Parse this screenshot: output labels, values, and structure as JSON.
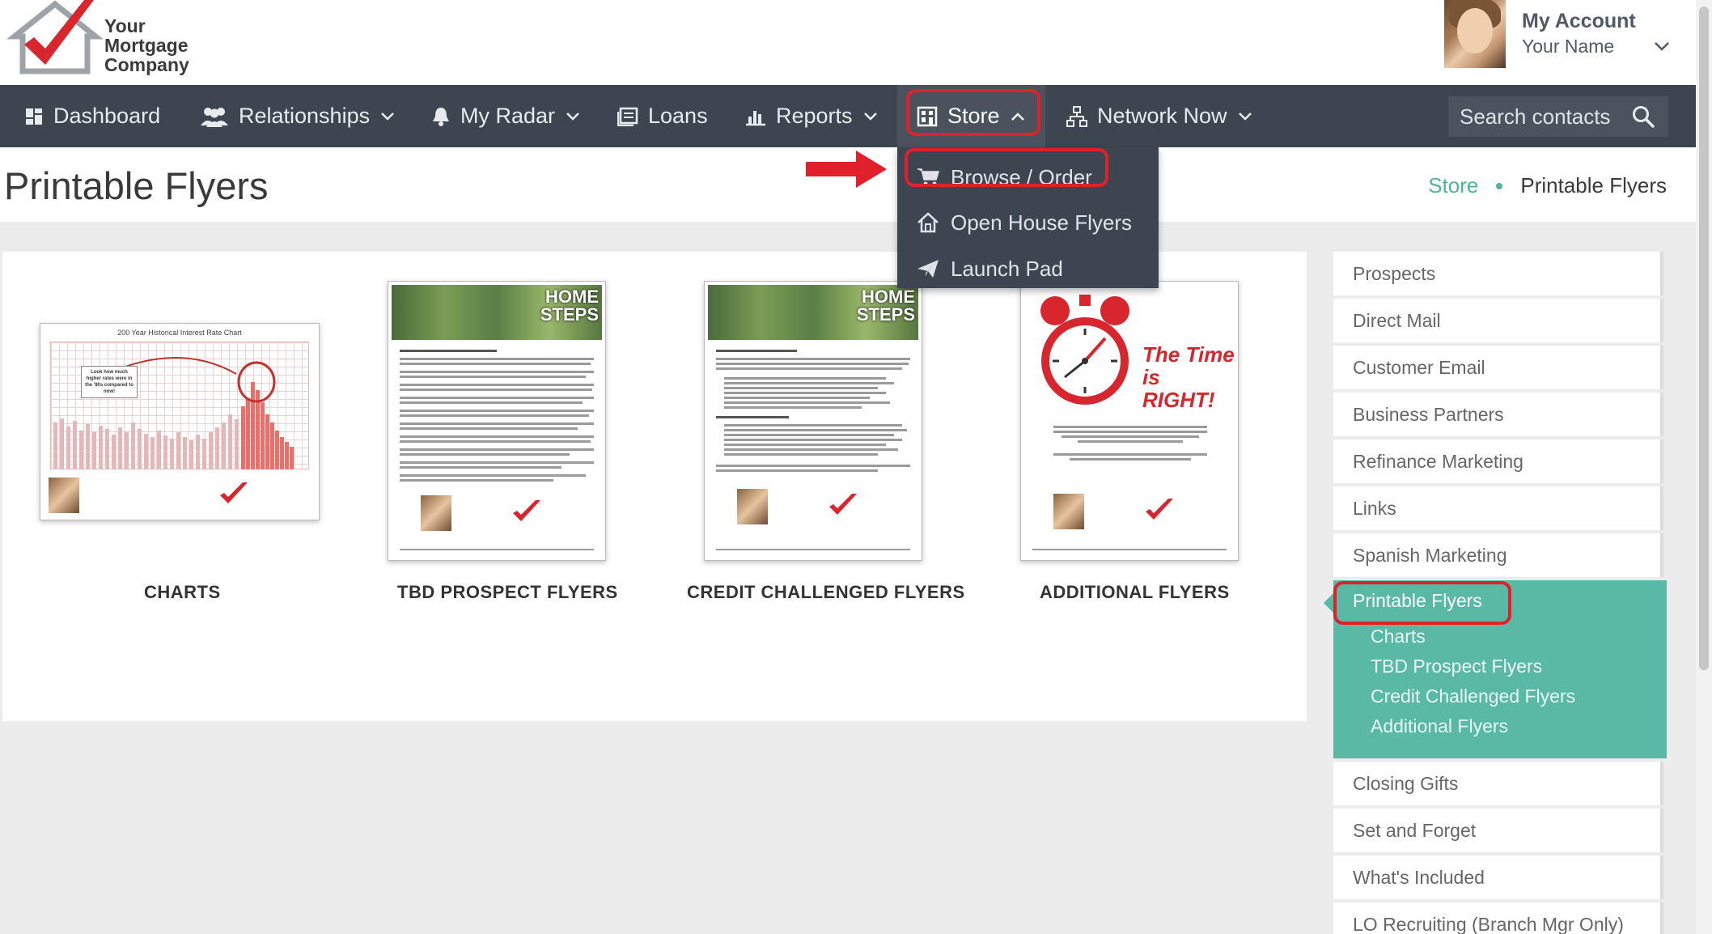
{
  "logo": {
    "line1": "Your",
    "line2": "Mortgage",
    "line3": "Company"
  },
  "account": {
    "title": "My Account",
    "name": "Your Name"
  },
  "nav": {
    "dashboard": "Dashboard",
    "relationships": "Relationships",
    "my_radar": "My Radar",
    "loans": "Loans",
    "reports": "Reports",
    "store": "Store",
    "network_now": "Network Now",
    "search_placeholder": "Search contacts"
  },
  "store_menu": {
    "items": [
      {
        "label": "Browse / Order",
        "icon": "cart-icon"
      },
      {
        "label": "Open House Flyers",
        "icon": "house-icon"
      },
      {
        "label": "Launch Pad",
        "icon": "paper-plane-icon"
      }
    ]
  },
  "page": {
    "title": "Printable Flyers",
    "breadcrumb": [
      "Store",
      "Printable Flyers"
    ]
  },
  "cards": [
    {
      "label": "CHARTS",
      "chart_title": "200 Year Historical Interest Rate Chart",
      "callout": "Look how much higher rates were in the '80s compared to now!"
    },
    {
      "label": "TBD PROSPECT FLYERS",
      "banner_line1": "HOME",
      "banner_line2": "STEPS"
    },
    {
      "label": "CREDIT CHALLENGED FLYERS",
      "banner_line1": "HOME",
      "banner_line2": "STEPS"
    },
    {
      "label": "ADDITIONAL FLYERS",
      "headline_line1": "The Time",
      "headline_line2": "is RIGHT!"
    }
  ],
  "sidebar": {
    "items_top": [
      "Prospects",
      "Direct Mail",
      "Customer Email",
      "Business Partners",
      "Refinance Marketing",
      "Links",
      "Spanish Marketing"
    ],
    "active": "Printable Flyers",
    "active_sub": [
      "Charts",
      "TBD Prospect Flyers",
      "Credit Challenged Flyers",
      "Additional Flyers"
    ],
    "items_bottom": [
      "Closing Gifts",
      "Set and Forget",
      "What's Included",
      "LO Recruiting (Branch Mgr Only)"
    ]
  },
  "colors": {
    "nav_bg": "#3d4650",
    "accent": "#59b9a5",
    "highlight": "#e0202a"
  }
}
